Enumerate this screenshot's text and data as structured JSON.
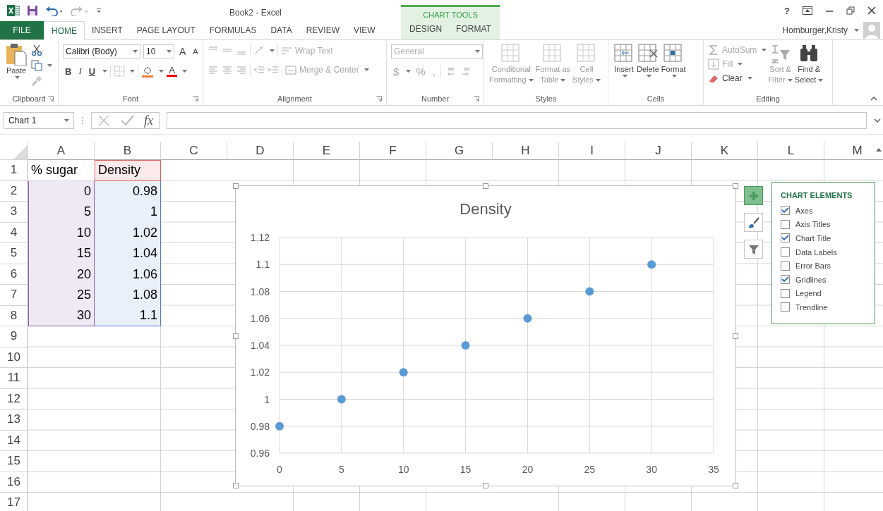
{
  "title_bar": {
    "title": "Book2 - Excel",
    "help": "?"
  },
  "tabs": [
    {
      "label": "FILE",
      "kind": "file",
      "selected": false
    },
    {
      "label": "HOME",
      "kind": "normal",
      "selected": true
    },
    {
      "label": "INSERT",
      "kind": "normal",
      "selected": false
    },
    {
      "label": "PAGE LAYOUT",
      "kind": "normal",
      "selected": false
    },
    {
      "label": "FORMULAS",
      "kind": "normal",
      "selected": false
    },
    {
      "label": "DATA",
      "kind": "normal",
      "selected": false
    },
    {
      "label": "REVIEW",
      "kind": "normal",
      "selected": false
    },
    {
      "label": "VIEW",
      "kind": "normal",
      "selected": false
    },
    {
      "label": "DESIGN",
      "kind": "context",
      "selected": false
    },
    {
      "label": "FORMAT",
      "kind": "context",
      "selected": false
    }
  ],
  "context_group": {
    "label": "CHART TOOLS"
  },
  "user": {
    "name": "Homburger,Kristy"
  },
  "ribbon": {
    "groups": [
      {
        "kind": "clipboard",
        "label": "Clipboard",
        "paste": "Paste"
      },
      {
        "kind": "font",
        "label": "Font",
        "font_name": "Calibri (Body)",
        "font_size": "10",
        "grow": "A",
        "shrink": "A",
        "bold": "B",
        "italic": "I",
        "underline": "U",
        "font_color": "A"
      },
      {
        "kind": "alignment",
        "label": "Alignment",
        "wrap_text": "Wrap Text",
        "merge": "Merge & Center",
        "disabled": true
      },
      {
        "kind": "number",
        "label": "Number",
        "format": "General",
        "currency": "$",
        "percent": "%",
        "comma": ",",
        "disabled": true
      },
      {
        "kind": "styles",
        "label": "Styles",
        "buttons": [
          {
            "lines": [
              "Conditional",
              "Formatting"
            ],
            "disabled": true
          },
          {
            "lines": [
              "Format as",
              "Table"
            ],
            "disabled": true
          },
          {
            "lines": [
              "Cell",
              "Styles"
            ],
            "disabled": true
          }
        ]
      },
      {
        "kind": "cells",
        "label": "Cells",
        "buttons": [
          {
            "lines": [
              "Insert"
            ],
            "disabled": false
          },
          {
            "lines": [
              "Delete"
            ],
            "disabled": false
          },
          {
            "lines": [
              "Format"
            ],
            "disabled": false
          }
        ]
      },
      {
        "kind": "editing",
        "label": "Editing",
        "small_buttons": [
          {
            "label": "AutoSum",
            "disabled": true
          },
          {
            "label": "Fill",
            "disabled": true
          },
          {
            "label": "Clear",
            "disabled": false
          }
        ],
        "buttons": [
          {
            "lines": [
              "Sort &",
              "Filter"
            ],
            "disabled": true
          },
          {
            "lines": [
              "Find &",
              "Select"
            ],
            "disabled": false
          }
        ]
      }
    ]
  },
  "formula_bar": {
    "name_box": "Chart 1",
    "function_label": "fx"
  },
  "sheet": {
    "columns": [
      "A",
      "B",
      "C",
      "D",
      "E",
      "F",
      "G",
      "H",
      "I",
      "J",
      "K",
      "L",
      "M"
    ],
    "rows": [
      {
        "header": "1",
        "cells": [
          "% sugar",
          "Density"
        ]
      },
      {
        "header": "2",
        "cells": [
          "0",
          "0.98"
        ]
      },
      {
        "header": "3",
        "cells": [
          "5",
          "1"
        ]
      },
      {
        "header": "4",
        "cells": [
          "10",
          "1.02"
        ]
      },
      {
        "header": "5",
        "cells": [
          "15",
          "1.04"
        ]
      },
      {
        "header": "6",
        "cells": [
          "20",
          "1.06"
        ]
      },
      {
        "header": "7",
        "cells": [
          "25",
          "1.08"
        ]
      },
      {
        "header": "8",
        "cells": [
          "30",
          "1.1"
        ]
      },
      {
        "header": "9",
        "cells": []
      },
      {
        "header": "10",
        "cells": []
      },
      {
        "header": "11",
        "cells": []
      },
      {
        "header": "12",
        "cells": []
      },
      {
        "header": "13",
        "cells": []
      },
      {
        "header": "14",
        "cells": []
      },
      {
        "header": "15",
        "cells": []
      },
      {
        "header": "16",
        "cells": []
      },
      {
        "header": "17",
        "cells": []
      }
    ]
  },
  "chart": {
    "chart_data": {
      "type": "scatter",
      "title": "Density",
      "grid": true,
      "x": [
        0,
        5,
        10,
        15,
        20,
        25,
        30
      ],
      "series": [
        {
          "color": "#5b9bd5",
          "values": [
            0.98,
            1,
            1.02,
            1.04,
            1.06,
            1.08,
            1.1
          ]
        }
      ],
      "xlim": [
        0,
        35
      ],
      "ylim": [
        0.96,
        1.12
      ],
      "xticks": [
        0,
        5,
        10,
        15,
        20,
        25,
        30,
        35
      ],
      "yticks": [
        {
          "value": 0.96,
          "label": "0.96"
        },
        {
          "value": 0.98,
          "label": "0.98"
        },
        {
          "value": 1,
          "label": "1"
        },
        {
          "value": 1.02,
          "label": "1.02"
        },
        {
          "value": 1.04,
          "label": "1.04"
        },
        {
          "value": 1.06,
          "label": "1.06"
        },
        {
          "value": 1.08,
          "label": "1.08"
        },
        {
          "value": 1.1,
          "label": "1.1"
        },
        {
          "value": 1.12,
          "label": "1.12"
        }
      ]
    }
  },
  "chart_buttons": [
    {
      "kind": "elements",
      "selected": true
    },
    {
      "kind": "styles",
      "selected": false
    },
    {
      "kind": "filters",
      "selected": false
    }
  ],
  "chart_elements": {
    "title": "CHART ELEMENTS",
    "items": [
      {
        "label": "Axes",
        "checked": true
      },
      {
        "label": "Axis Titles",
        "checked": false
      },
      {
        "label": "Chart Title",
        "checked": true
      },
      {
        "label": "Data Labels",
        "checked": false
      },
      {
        "label": "Error Bars",
        "checked": false
      },
      {
        "label": "Gridlines",
        "checked": true
      },
      {
        "label": "Legend",
        "checked": false
      },
      {
        "label": "Trendline",
        "checked": false
      }
    ]
  }
}
